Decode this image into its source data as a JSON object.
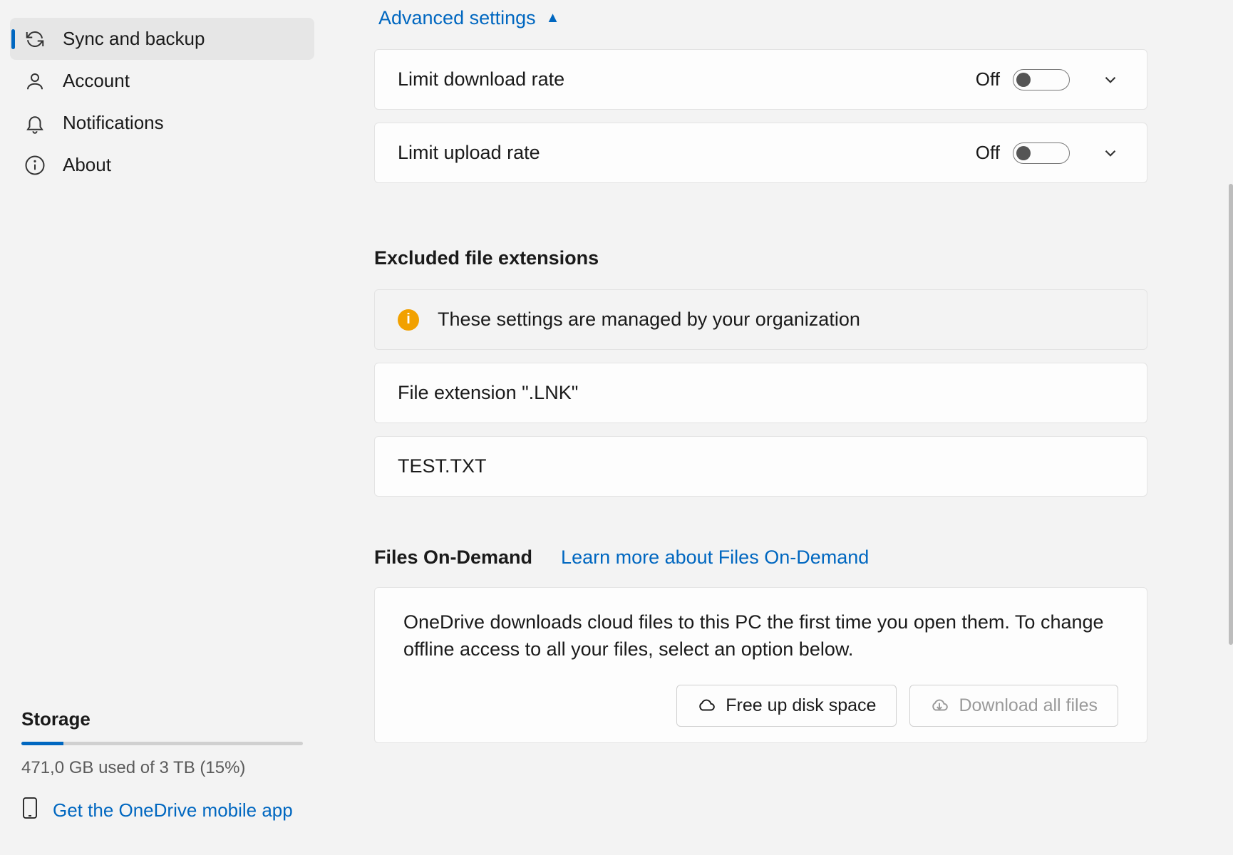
{
  "sidebar": {
    "items": [
      {
        "label": "Sync and backup"
      },
      {
        "label": "Account"
      },
      {
        "label": "Notifications"
      },
      {
        "label": "About"
      }
    ],
    "storage": {
      "title": "Storage",
      "percent": 15,
      "text": "471,0 GB used of 3 TB (15%)"
    },
    "mobile_link": "Get the OneDrive mobile app"
  },
  "main": {
    "advanced_link": "Advanced settings",
    "limit_download": {
      "label": "Limit download rate",
      "state": "Off"
    },
    "limit_upload": {
      "label": "Limit upload rate",
      "state": "Off"
    },
    "excluded": {
      "title": "Excluded file extensions",
      "info": "These settings are managed by your organization",
      "items": [
        "File extension \".LNK\"",
        "TEST.TXT"
      ]
    },
    "fod": {
      "title": "Files On-Demand",
      "learn": "Learn more about Files On-Demand",
      "desc": "OneDrive downloads cloud files to this PC the first time you open them. To change offline access to all your files, select an option below.",
      "btn_free": "Free up disk space",
      "btn_download": "Download all files"
    }
  }
}
